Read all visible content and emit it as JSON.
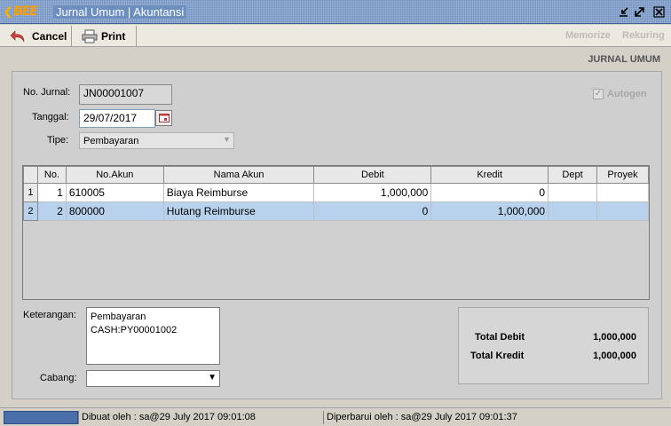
{
  "window": {
    "logo": "BEE",
    "title": "Jurnal Umum | Akuntansi"
  },
  "toolbar": {
    "cancel_label": "Cancel",
    "print_label": "Print",
    "memorize_label": "Memorize",
    "rekuring_label": "Rekuring"
  },
  "form": {
    "header": "JURNAL UMUM",
    "no_jurnal_label": "No. Jurnal:",
    "no_jurnal_value": "JN00001007",
    "tanggal_label": "Tanggal:",
    "tanggal_value": "29/07/2017",
    "tipe_label": "Tipe:",
    "tipe_value": "Pembayaran",
    "autogen_label": "Autogen"
  },
  "grid": {
    "columns": [
      "No.",
      "No.Akun",
      "Nama Akun",
      "Debit",
      "Kredit",
      "Dept",
      "Proyek"
    ],
    "rows": [
      {
        "rownum": "1",
        "no": "1",
        "akun": "610005",
        "nama": "Biaya Reimburse",
        "debit": "1,000,000",
        "kredit": "0",
        "dept": "",
        "proyek": ""
      },
      {
        "rownum": "2",
        "no": "2",
        "akun": "800000",
        "nama": "Hutang Reimburse",
        "debit": "0",
        "kredit": "1,000,000",
        "dept": "",
        "proyek": ""
      }
    ]
  },
  "footer": {
    "keterangan_label": "Keterangan:",
    "keterangan_line1": "Pembayaran",
    "keterangan_line2": "CASH:PY00001002",
    "cabang_label": "Cabang:",
    "cabang_value": "",
    "total_debit_label": "Total Debit",
    "total_debit_value": "1,000,000",
    "total_kredit_label": "Total Kredit",
    "total_kredit_value": "1,000,000"
  },
  "status": {
    "dibuat": "Dibuat oleh : sa@29 July 2017  09:01:08",
    "diperbarui": "Diperbarui oleh : sa@29 July 2017  09:01:37"
  },
  "colors": {
    "titlebar": "#6d8fc0",
    "selected_row": "#b8d2ee",
    "logo_orange": "#ff9c00"
  }
}
